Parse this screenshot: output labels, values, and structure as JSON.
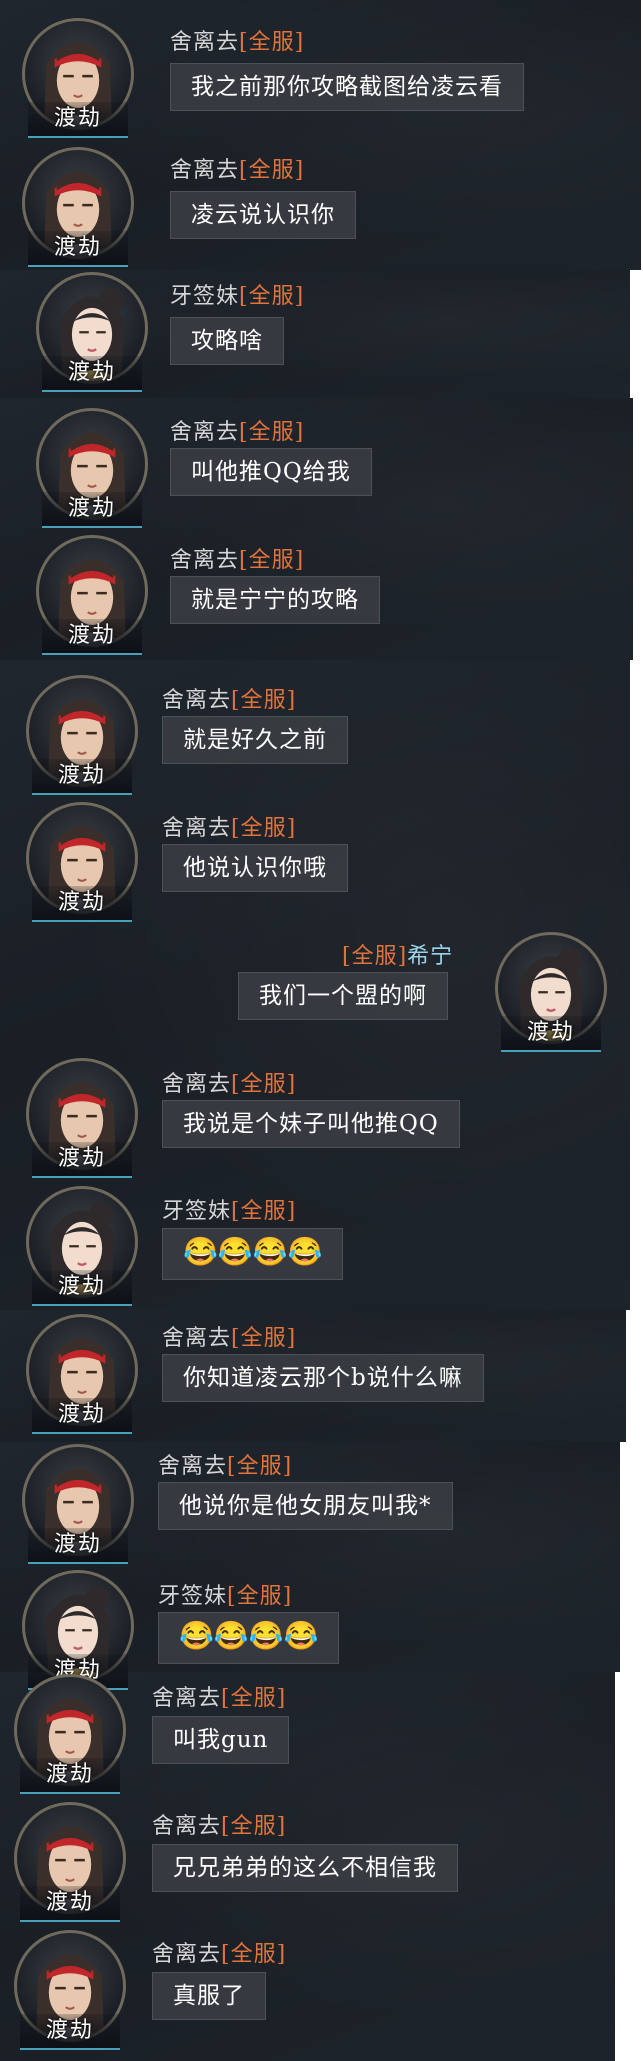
{
  "server_tag": "[全服]",
  "messages": [
    {
      "sender": "舍离去",
      "avatar_label": "渡劫",
      "avatar_icon": "male-avatar-red-headband-icon",
      "text": "我之前那你攻略截图给凌云看",
      "side": "left"
    },
    {
      "sender": "舍离去",
      "avatar_label": "渡劫",
      "avatar_icon": "male-avatar-red-headband-icon",
      "text": "凌云说认识你",
      "side": "left"
    },
    {
      "sender": "牙签妹",
      "avatar_label": "渡劫",
      "avatar_icon": "female-avatar-icon",
      "text": "攻略啥",
      "side": "left"
    },
    {
      "sender": "舍离去",
      "avatar_label": "渡劫",
      "avatar_icon": "male-avatar-red-headband-icon",
      "text": "叫他推QQ给我",
      "side": "left"
    },
    {
      "sender": "舍离去",
      "avatar_label": "渡劫",
      "avatar_icon": "male-avatar-red-headband-icon",
      "text": "就是宁宁的攻略",
      "side": "left"
    },
    {
      "sender": "舍离去",
      "avatar_label": "渡劫",
      "avatar_icon": "male-avatar-red-headband-icon",
      "text": "就是好久之前",
      "side": "left"
    },
    {
      "sender": "舍离去",
      "avatar_label": "渡劫",
      "avatar_icon": "male-avatar-red-headband-icon",
      "text": "他说认识你哦",
      "side": "left"
    },
    {
      "sender": "希宁",
      "avatar_label": "渡劫",
      "avatar_icon": "female-avatar-icon",
      "text": "我们一个盟的啊",
      "side": "right"
    },
    {
      "sender": "舍离去",
      "avatar_label": "渡劫",
      "avatar_icon": "male-avatar-red-headband-icon",
      "text": "我说是个妹子叫他推QQ",
      "side": "left"
    },
    {
      "sender": "牙签妹",
      "avatar_label": "渡劫",
      "avatar_icon": "female-avatar-icon",
      "text": "😂😂😂😂",
      "side": "left"
    },
    {
      "sender": "舍离去",
      "avatar_label": "渡劫",
      "avatar_icon": "male-avatar-red-headband-icon",
      "text": "你知道凌云那个b说什么嘛",
      "side": "left"
    },
    {
      "sender": "舍离去",
      "avatar_label": "渡劫",
      "avatar_icon": "male-avatar-red-headband-icon",
      "text": "他说你是他女朋友叫我*",
      "side": "left"
    },
    {
      "sender": "牙签妹",
      "avatar_label": "渡劫",
      "avatar_icon": "female-avatar-icon",
      "text": "😂😂😂😂",
      "side": "left"
    },
    {
      "sender": "舍离去",
      "avatar_label": "渡劫",
      "avatar_icon": "male-avatar-red-headband-icon",
      "text": "叫我gun",
      "side": "left"
    },
    {
      "sender": "舍离去",
      "avatar_label": "渡劫",
      "avatar_icon": "male-avatar-red-headband-icon",
      "text": "兄兄弟弟的这么不相信我",
      "side": "left"
    },
    {
      "sender": "舍离去",
      "avatar_label": "渡劫",
      "avatar_icon": "male-avatar-red-headband-icon",
      "text": "真服了",
      "side": "left"
    }
  ]
}
